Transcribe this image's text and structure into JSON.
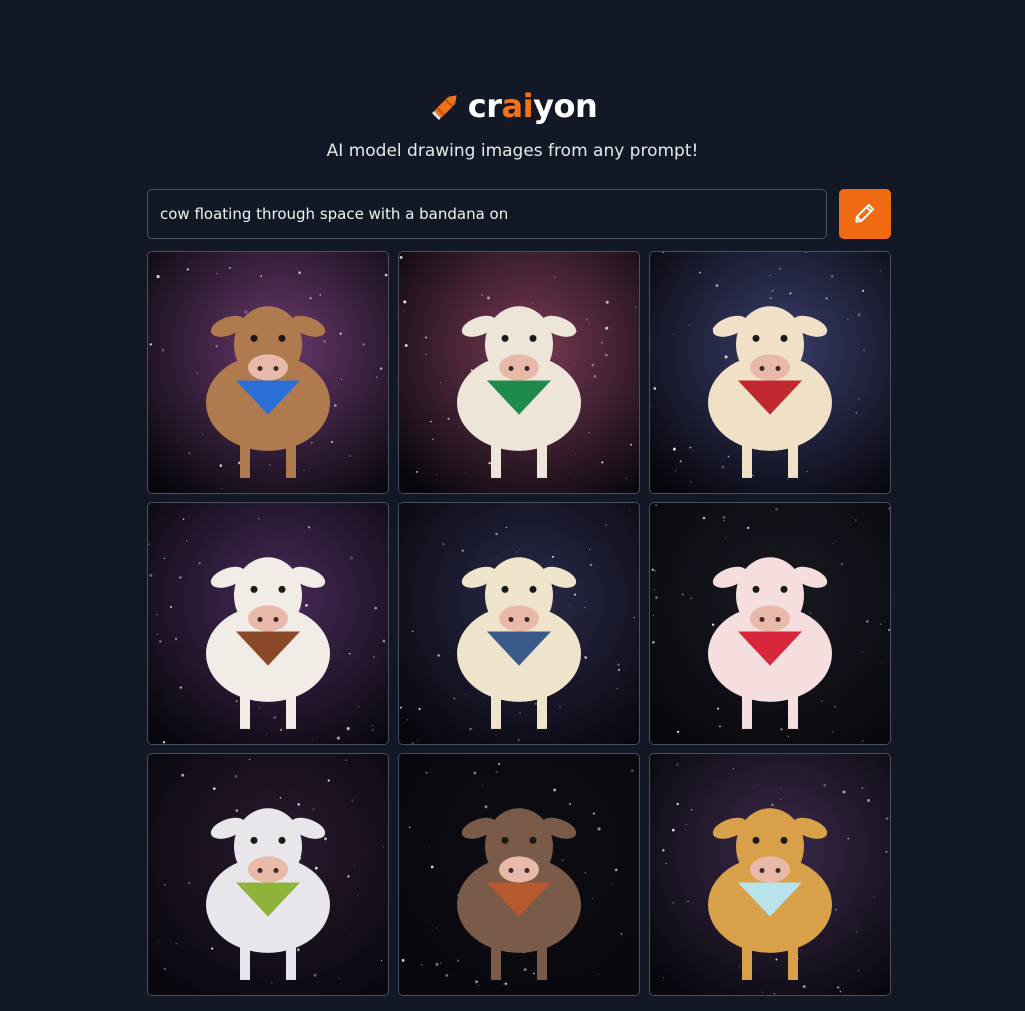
{
  "header": {
    "logo_prefix": "cr",
    "logo_accent": "ai",
    "logo_suffix": "yon",
    "tagline": "AI model drawing images from any prompt!",
    "accent_color": "#f0731a"
  },
  "prompt": {
    "value": "cow floating through space with a bandana on"
  },
  "draw_button": {
    "icon": "pencil-icon",
    "color": "#ef6a12"
  },
  "results": [
    {
      "cow_color": "#b07a4f",
      "bandana": "#2b6fd4",
      "space": "#6b3a6e"
    },
    {
      "cow_color": "#ede6d8",
      "bandana": "#1e8a4c",
      "space": "#7a3a55"
    },
    {
      "cow_color": "#efe0c6",
      "bandana": "#c0282e",
      "space": "#3a3d6a"
    },
    {
      "cow_color": "#f1ece6",
      "bandana": "#8a4a2a",
      "space": "#4a2a5a"
    },
    {
      "cow_color": "#efe3cc",
      "bandana": "#3a5a8a",
      "space": "#2a2a4a"
    },
    {
      "cow_color": "#f6dede",
      "bandana": "#d8263a",
      "space": "#1a1a22"
    },
    {
      "cow_color": "#e8e6ea",
      "bandana": "#8fb33a",
      "space": "#2a1a30"
    },
    {
      "cow_color": "#7a5a48",
      "bandana": "#b85a30",
      "space": "#0e0e14"
    },
    {
      "cow_color": "#d9a04a",
      "bandana": "#b8e2ec",
      "space": "#3a2a4a"
    }
  ]
}
